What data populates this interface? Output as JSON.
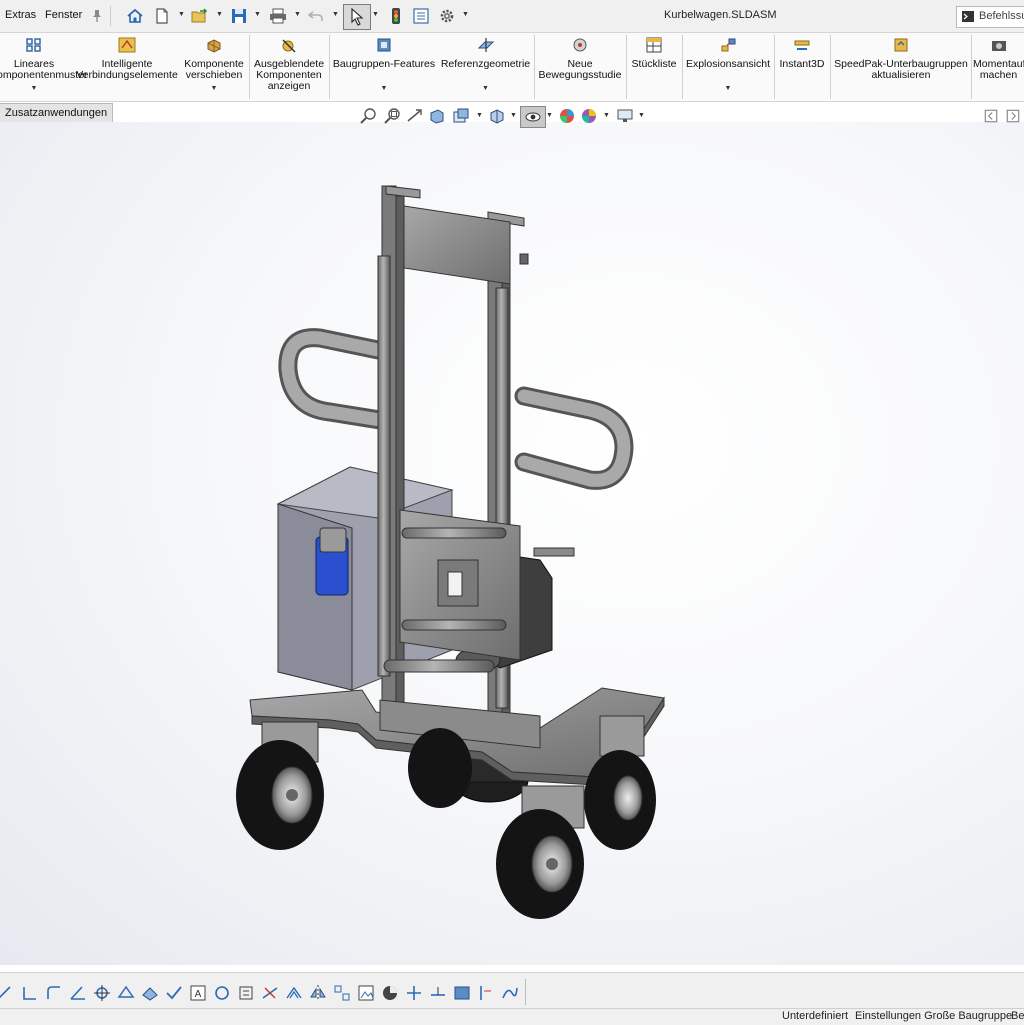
{
  "menu": {
    "extras": "Extras",
    "fenster": "Fenster"
  },
  "document": {
    "title": "Kurbelwagen.SLDASM"
  },
  "search": {
    "label": "Befehlssuche"
  },
  "commands": [
    {
      "line1": "Lineares",
      "line2": "Komponentenmuster",
      "line3": ""
    },
    {
      "line1": "Intelligente",
      "line2": "Verbindungselemente",
      "line3": ""
    },
    {
      "line1": "Komponente",
      "line2": "verschieben",
      "line3": ""
    },
    {
      "line1": "Ausgeblendete",
      "line2": "Komponenten",
      "line3": "anzeigen"
    },
    {
      "line1": "Baugruppen-Features",
      "line2": "",
      "line3": ""
    },
    {
      "line1": "Referenzgeometrie",
      "line2": "",
      "line3": ""
    },
    {
      "line1": "Neue",
      "line2": "Bewegungsstudie",
      "line3": ""
    },
    {
      "line1": "Stückliste",
      "line2": "",
      "line3": ""
    },
    {
      "line1": "Explosionsansicht",
      "line2": "",
      "line3": ""
    },
    {
      "line1": "Instant3D",
      "line2": "",
      "line3": ""
    },
    {
      "line1": "SpeedPak-Unterbaugruppen",
      "line2": "aktualisieren",
      "line3": ""
    },
    {
      "line1": "Momentaufnahme",
      "line2": "machen",
      "line3": ""
    }
  ],
  "tabs": {
    "active": "Zusatzanwendungen"
  },
  "status": {
    "definition": "Unterdefiniert",
    "settings": "Einstellungen Große Baugruppe",
    "edit": "Bearbeiten"
  },
  "colors": {
    "accent": "#0a5fb4",
    "frame": "#8c8c8c",
    "tire": "#141414",
    "socket": "#2a4fcf"
  }
}
